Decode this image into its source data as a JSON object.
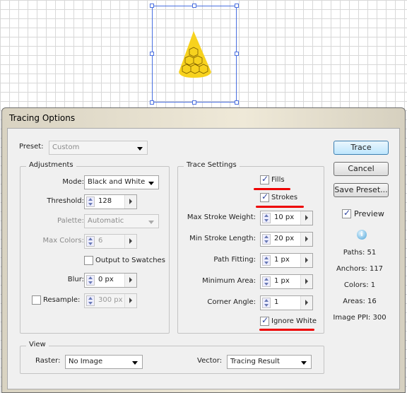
{
  "dialog": {
    "title": "Tracing Options"
  },
  "preset": {
    "label": "Preset:",
    "value": "Custom"
  },
  "adjustments": {
    "legend": "Adjustments",
    "mode_label": "Mode:",
    "mode_value": "Black and White",
    "threshold_label": "Threshold:",
    "threshold_value": "128",
    "palette_label": "Palette:",
    "palette_value": "Automatic",
    "max_colors_label": "Max Colors:",
    "max_colors_value": "6",
    "output_swatches_label": "Output to Swatches",
    "output_swatches_checked": false,
    "blur_label": "Blur:",
    "blur_value": "0 px",
    "resample_label": "Resample:",
    "resample_checked": false,
    "resample_value": "300 px"
  },
  "trace_settings": {
    "legend": "Trace Settings",
    "fills_label": "Fills",
    "fills_checked": true,
    "strokes_label": "Strokes",
    "strokes_checked": true,
    "max_stroke_weight_label": "Max Stroke Weight:",
    "max_stroke_weight_value": "10 px",
    "min_stroke_length_label": "Min Stroke Length:",
    "min_stroke_length_value": "20 px",
    "path_fitting_label": "Path Fitting:",
    "path_fitting_value": "1 px",
    "minimum_area_label": "Minimum Area:",
    "minimum_area_value": "1 px",
    "corner_angle_label": "Corner Angle:",
    "corner_angle_value": "1",
    "ignore_white_label": "Ignore White",
    "ignore_white_checked": true
  },
  "buttons": {
    "trace": "Trace",
    "cancel": "Cancel",
    "save_preset": "Save Preset..."
  },
  "preview": {
    "label": "Preview",
    "checked": true
  },
  "stats": {
    "paths": "Paths: 51",
    "anchors": "Anchors: 117",
    "colors": "Colors: 1",
    "areas": "Areas: 16",
    "image_ppi": "Image PPI: 300"
  },
  "view": {
    "legend": "View",
    "raster_label": "Raster:",
    "raster_value": "No Image",
    "vector_label": "Vector:",
    "vector_value": "Tracing Result"
  },
  "colors": {
    "annotation": "#e00000",
    "shape_fill": "#f7d21e",
    "selection": "#4a6fe0"
  }
}
